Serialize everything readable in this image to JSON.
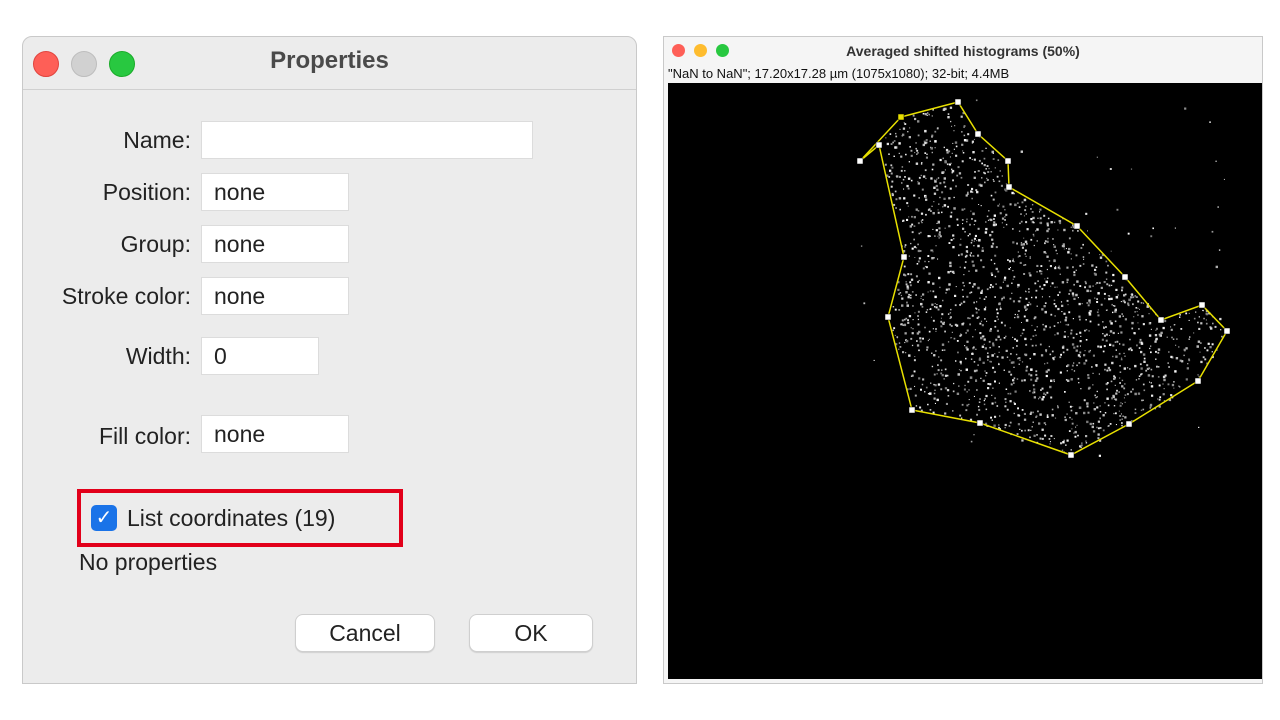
{
  "dialog": {
    "title": "Properties",
    "fields": {
      "name": {
        "label": "Name:",
        "value": ""
      },
      "position": {
        "label": "Position:",
        "value": "none"
      },
      "group": {
        "label": "Group:",
        "value": "none"
      },
      "stroke_color": {
        "label": "Stroke color:",
        "value": "none"
      },
      "width": {
        "label": "Width:",
        "value": "0"
      },
      "fill_color": {
        "label": "Fill color:",
        "value": "none"
      }
    },
    "list_coordinates": {
      "label": "List coordinates (19)",
      "checked": true
    },
    "no_properties": "No properties",
    "buttons": {
      "cancel": "Cancel",
      "ok": "OK"
    },
    "highlight_color": "#e2001a"
  },
  "image_window": {
    "title": "Averaged shifted histograms (50%)",
    "info": "\"NaN to NaN\"; 17.20x17.28 µm (1075x1080); 32-bit; 4.4MB",
    "roi_color": "#e8e000",
    "background_color": "#000000"
  }
}
